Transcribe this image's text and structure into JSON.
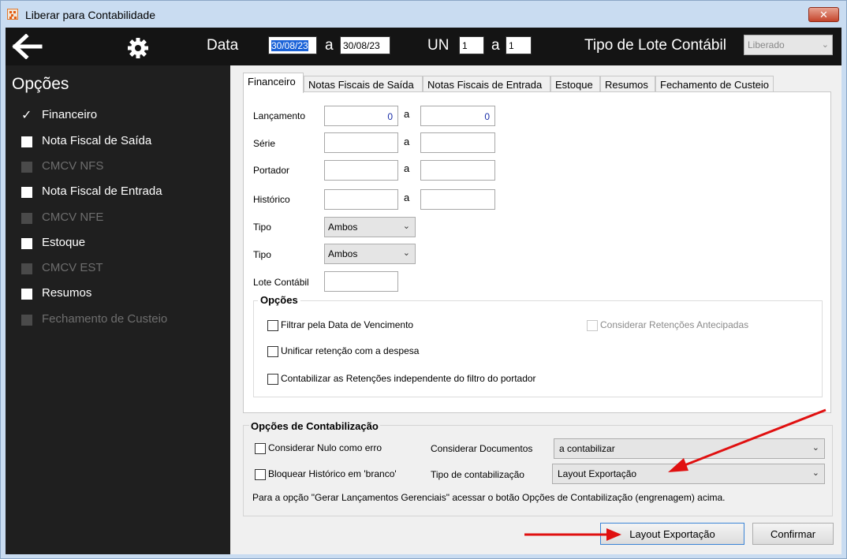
{
  "window": {
    "title": "Liberar para Contabilidade",
    "close_label": "✕"
  },
  "toolbar": {
    "data_label": "Data",
    "date_from": "30/08/23",
    "a1": "a",
    "date_to": "30/08/23",
    "un_label": "UN",
    "un_from": "1",
    "a2": "a",
    "un_to": "1",
    "tipo_label": "Tipo de Lote Contábil",
    "tipo_value": "Liberado"
  },
  "sidebar": {
    "title": "Opções",
    "items": [
      {
        "label": "Financeiro",
        "checked": true,
        "enabled": true
      },
      {
        "label": "Nota Fiscal de Saída",
        "checked": false,
        "enabled": true
      },
      {
        "label": "CMCV NFS",
        "checked": false,
        "enabled": false
      },
      {
        "label": "Nota Fiscal de Entrada",
        "checked": false,
        "enabled": true
      },
      {
        "label": "CMCV NFE",
        "checked": false,
        "enabled": false
      },
      {
        "label": "Estoque",
        "checked": false,
        "enabled": true
      },
      {
        "label": "CMCV EST",
        "checked": false,
        "enabled": false
      },
      {
        "label": "Resumos",
        "checked": false,
        "enabled": true
      },
      {
        "label": "Fechamento de Custeio",
        "checked": false,
        "enabled": false
      }
    ]
  },
  "tabs": [
    {
      "label": "Financeiro",
      "active": true
    },
    {
      "label": "Notas Fiscais de Saída"
    },
    {
      "label": "Notas Fiscais de Entrada"
    },
    {
      "label": "Estoque"
    },
    {
      "label": "Resumos"
    },
    {
      "label": "Fechamento de Custeio"
    }
  ],
  "financeiro": {
    "lancamento_label": "Lançamento",
    "lancamento_from": "0",
    "lancamento_to": "0",
    "serie_label": "Série",
    "portador_label": "Portador",
    "historico_label": "Histórico",
    "a": "a",
    "tipo1_label": "Tipo",
    "tipo1_value": "Ambos",
    "tipo2_label": "Tipo",
    "tipo2_value": "Ambos",
    "lote_label": "Lote Contábil",
    "opcoes_title": "Opções",
    "cb_filtrar": "Filtrar pela Data de Vencimento",
    "cb_considerar_ret": "Considerar Retenções Antecipadas",
    "cb_unificar": "Unificar retenção com a despesa",
    "cb_contabilizar_ret": "Contabilizar as Retenções independente do filtro do portador"
  },
  "contabilizacao": {
    "title": "Opções de Contabilização",
    "cb_nulo": "Considerar Nulo como erro",
    "cb_bloquear": "Bloquear Histórico em 'branco'",
    "docs_label": "Considerar Documentos",
    "docs_value": "a contabilizar",
    "tipo_label": "Tipo de contabilização",
    "tipo_value": "Layout Exportação",
    "note": "Para a opção \"Gerar Lançamentos Gerenciais\" acessar o botão Opções de Contabilização (engrenagem) acima."
  },
  "buttons": {
    "layout": "Layout Exportação",
    "confirmar": "Confirmar"
  },
  "colors": {
    "toolbar_bg": "#141414",
    "sidebar_bg": "#1f1f1f",
    "annotation_arrow": "#e01010",
    "selection": "#1b63d8"
  },
  "icons": {
    "back": "arrow-left-icon",
    "settings": "gear-icon",
    "app": "app-logo-icon",
    "close": "close-icon"
  }
}
